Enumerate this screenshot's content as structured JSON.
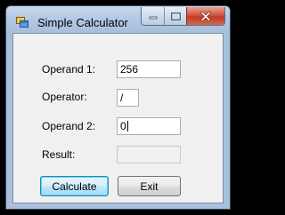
{
  "window": {
    "title": "Simple Calculator"
  },
  "form": {
    "operand1": {
      "label": "Operand 1:",
      "value": "256"
    },
    "operator": {
      "label": "Operator:",
      "value": "/"
    },
    "operand2": {
      "label": "Operand 2:",
      "value": "0"
    },
    "result": {
      "label": "Result:",
      "value": ""
    }
  },
  "buttons": {
    "calculate": "Calculate",
    "exit": "Exit"
  },
  "colors": {
    "titlebar": "#b4c9e3",
    "client_background": "#f0f0f0",
    "close_button": "#c23a22",
    "default_button_border": "#3c7fb1"
  }
}
